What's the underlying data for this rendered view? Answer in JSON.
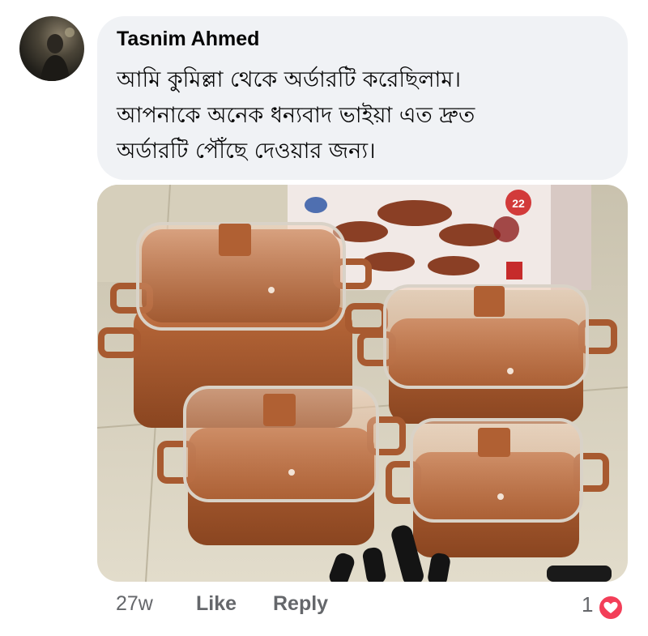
{
  "comment": {
    "author": "Tasnim Ahmed",
    "lines": [
      "আমি কুমিল্লা থেকে অর্ডারটি করেছিলাম।",
      "আপনাকে অনেক ধন্যবাদ ভাইয়া এত দ্রুত",
      "অর্ডারটি পৌঁছে দেওয়ার জন্য।"
    ]
  },
  "photo": {
    "box_badge": "22"
  },
  "actions": {
    "time": "27w",
    "like_label": "Like",
    "reply_label": "Reply",
    "reaction_count": "1"
  },
  "colors": {
    "bubble": "#f0f2f5",
    "meta_text": "#65676b",
    "heart": "#f33e58"
  }
}
